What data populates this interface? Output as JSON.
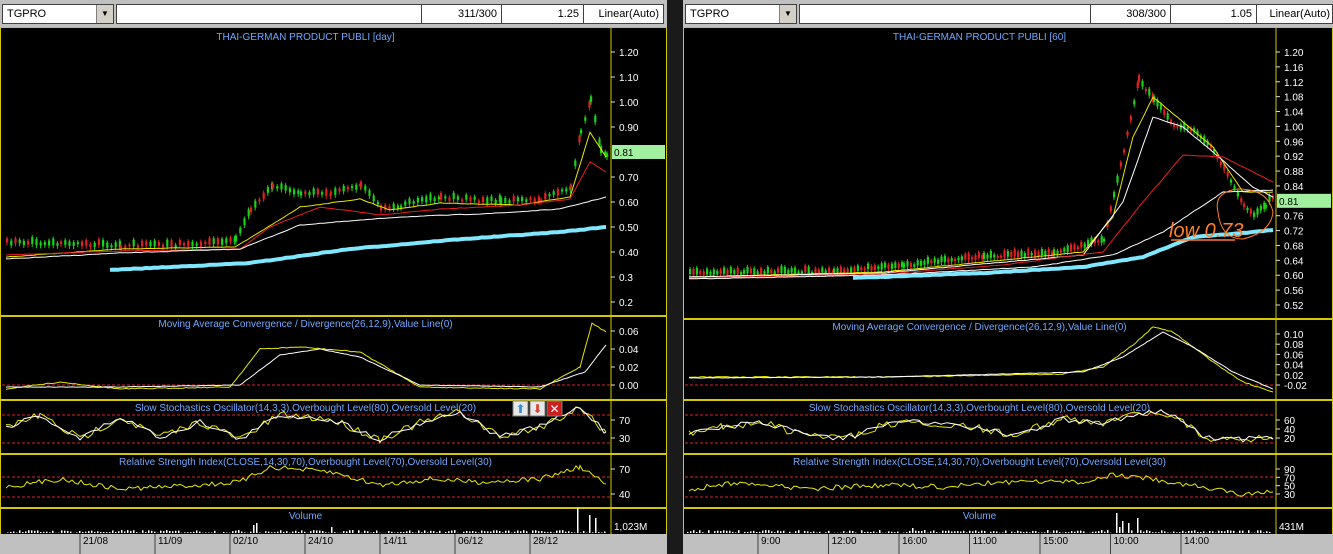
{
  "left": {
    "symbol": "TGPRO",
    "count": "311/300",
    "zoom": "1.25",
    "scale": "Linear(Auto)",
    "main_title": "THAI-GERMAN PRODUCT PUBLI [day]",
    "price_ticks": [
      "1.20",
      "1.10",
      "1.00",
      "0.90",
      "0.81",
      "0.70",
      "0.60",
      "0.50",
      "0.40",
      "0.3",
      "0.2"
    ],
    "last_price": "0.81",
    "macd_title": "Moving Average Convergence / Divergence(26,12,9),Value Line(0)",
    "macd_ticks": [
      "0.06",
      "0.04",
      "0.02",
      "0.00"
    ],
    "stoch_title": "Slow Stochastics Oscillator(14,3,3),Overbought Level(80),Oversold Level(20)",
    "stoch_ticks": [
      "70",
      "30"
    ],
    "rsi_title": "Relative Strength Index(CLOSE,14,30,70),Overbought Level(70),Oversold Level(30)",
    "rsi_ticks": [
      "70",
      "40"
    ],
    "volume_title": "Volume",
    "volume_tick": "1,023M",
    "dates": [
      "21/08",
      "11/09",
      "02/10",
      "24/10",
      "14/11",
      "06/12",
      "28/12"
    ]
  },
  "right": {
    "symbol": "TGPRO",
    "count": "308/300",
    "zoom": "1.05",
    "scale": "Linear(Auto)",
    "main_title": "THAI-GERMAN PRODUCT PUBLI [60]",
    "price_ticks": [
      "1.20",
      "1.16",
      "1.12",
      "1.08",
      "1.04",
      "1.00",
      "0.96",
      "0.92",
      "0.88",
      "0.84",
      "0.81",
      "0.76",
      "0.72",
      "0.68",
      "0.64",
      "0.60",
      "0.56",
      "0.52"
    ],
    "last_price": "0.81",
    "annotation": "low 0.73",
    "macd_title": "Moving Average Convergence / Divergence(26,12,9),Value Line(0)",
    "macd_ticks": [
      "0.10",
      "0.08",
      "0.06",
      "0.04",
      "0.02",
      "-0.02"
    ],
    "stoch_title": "Slow Stochastics Oscillator(14,3,3),Overbought Level(80),Oversold Level(20)",
    "stoch_ticks": [
      "60",
      "40",
      "20"
    ],
    "rsi_title": "Relative Strength Index(CLOSE,14,30,70),Overbought Level(70),Oversold Level(30)",
    "rsi_ticks": [
      "90",
      "70",
      "50",
      "30"
    ],
    "volume_title": "Volume",
    "volume_tick": "431M",
    "times": [
      "9:00",
      "12:00",
      "16:00",
      "11:00",
      "15:00",
      "10:00",
      "14:00"
    ]
  },
  "colors": {
    "title_blue": "#6fa8ff",
    "frame": "#d4c800",
    "up_candle": "#19d219",
    "down_candle": "#e02020",
    "ma_white": "#ffffff",
    "ma_cyan": "#7fe8ff",
    "ma_red": "#e82020",
    "ma_yellow": "#e8e800",
    "price_tag_bg": "#a0f0a0",
    "annotation": "#ff7f27"
  },
  "icons": {
    "stoch_controls": [
      "arrow-up-icon",
      "arrow-down-icon",
      "close-icon"
    ]
  }
}
